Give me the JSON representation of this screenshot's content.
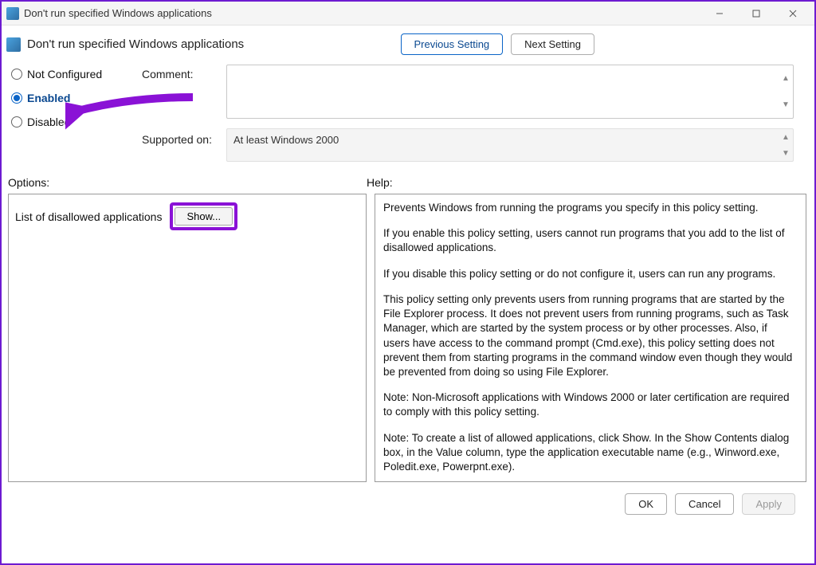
{
  "window": {
    "title": "Don't run specified Windows applications"
  },
  "header": {
    "policy_title": "Don't run specified Windows applications",
    "prev": "Previous Setting",
    "next": "Next Setting"
  },
  "state": {
    "not_configured": "Not Configured",
    "enabled": "Enabled",
    "disabled": "Disabled",
    "comment_label": "Comment:",
    "supported_label": "Supported on:",
    "supported_value": "At least Windows 2000"
  },
  "labels": {
    "options": "Options:",
    "help": "Help:"
  },
  "options_pane": {
    "disallowed_label": "List of disallowed applications",
    "show_button": "Show..."
  },
  "help_pane": {
    "p1": "Prevents Windows from running the programs you specify in this policy setting.",
    "p2": "If you enable this policy setting, users cannot run programs that you add to the list of disallowed applications.",
    "p3": "If you disable this policy setting or do not configure it, users can run any programs.",
    "p4": "This policy setting only prevents users from running programs that are started by the File Explorer process. It does not prevent users from running programs, such as Task Manager, which are started by the system process or by other processes.  Also, if users have access to the command prompt (Cmd.exe), this policy setting does not prevent them from starting programs in the command window even though they would be prevented from doing so using File Explorer.",
    "p5": "Note: Non-Microsoft applications with Windows 2000 or later certification are required to comply with this policy setting.",
    "p6": "Note: To create a list of allowed applications, click Show.  In the Show Contents dialog box, in the Value column, type the application executable name (e.g., Winword.exe, Poledit.exe, Powerpnt.exe)."
  },
  "footer": {
    "ok": "OK",
    "cancel": "Cancel",
    "apply": "Apply"
  }
}
